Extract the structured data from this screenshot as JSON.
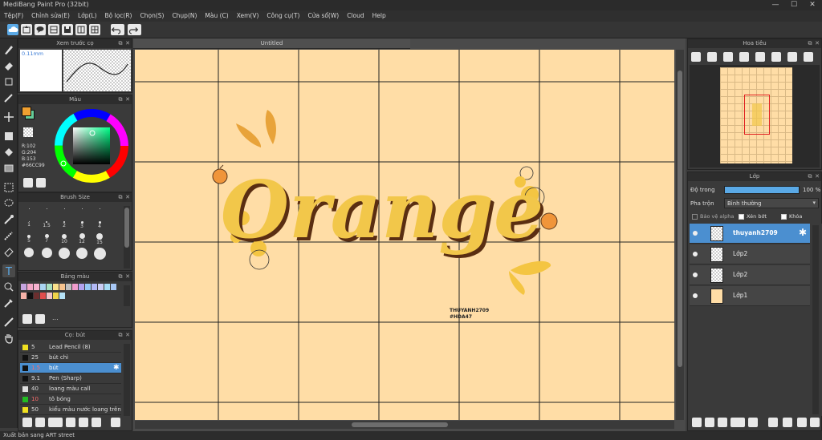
{
  "window": {
    "title": "MediBang Paint Pro (32bit)",
    "minimize": "—",
    "maximize": "☐",
    "close": "✕"
  },
  "menu": [
    "Tệp(F)",
    "Chỉnh sửa(E)",
    "Lớp(L)",
    "Bộ lọc(R)",
    "Chọn(S)",
    "Chụp(N)",
    "Màu (C)",
    "Xem(V)",
    "Công cụ(T)",
    "Cửa sổ(W)",
    "Cloud",
    "Help"
  ],
  "preview_panel": {
    "title": "Xem trước cọ",
    "size_label": "0.11mm"
  },
  "color_panel": {
    "title": "Màu",
    "r": "R:102",
    "g": "G:204",
    "b": "B:153",
    "hex": "#66CC99",
    "primary": "#f0a030",
    "secondary": "#66cc99"
  },
  "brush_size_panel": {
    "title": "Brush Size",
    "labels_row1": [
      "1",
      "1.5",
      "2",
      "3",
      "4"
    ],
    "labels_row2": [
      "5",
      "7",
      "10",
      "12",
      "15"
    ]
  },
  "palette_panel": {
    "title": "Bảng màu",
    "more": "..."
  },
  "brush_panel": {
    "title": "Cọ: bút",
    "items": [
      {
        "size": "5",
        "name": "Lead Pencil (8)",
        "color": "#f0e020"
      },
      {
        "size": "25",
        "name": "bút chì",
        "color": "#111111"
      },
      {
        "size": "1.5",
        "name": "bút",
        "color": "#111111"
      },
      {
        "size": "9.1",
        "name": "Pen (Sharp)",
        "color": "#111111"
      },
      {
        "size": "40",
        "name": "loang màu call",
        "color": "#dddddd"
      },
      {
        "size": "10",
        "name": "tô bóng",
        "color": "#22bb22"
      },
      {
        "size": "50",
        "name": "kiểu màu nước loang trên",
        "color": "#f0e020"
      }
    ]
  },
  "canvas": {
    "tab": "Untitled",
    "text_orange": "Orange",
    "signature_line1": "THUYANH2709",
    "signature_line2": "#HDA47"
  },
  "navigator_panel": {
    "title": "Hoa tiêu"
  },
  "layer_panel": {
    "title": "Lớp",
    "opacity_label": "Độ trong",
    "opacity_value": "100 %",
    "opacity_fraction": 1.0,
    "blend_label": "Pha trộn",
    "blend_value": "Bình thường",
    "protect_alpha": "Bảo vệ alpha",
    "clipping": "Xén bớt",
    "lock": "Khóa",
    "layers": [
      {
        "name": "thuyanh2709"
      },
      {
        "name": "Lớp2"
      },
      {
        "name": "Lớp2"
      },
      {
        "name": "Lớp1"
      }
    ]
  },
  "status": {
    "text": "Xuất bản sang ART street"
  }
}
